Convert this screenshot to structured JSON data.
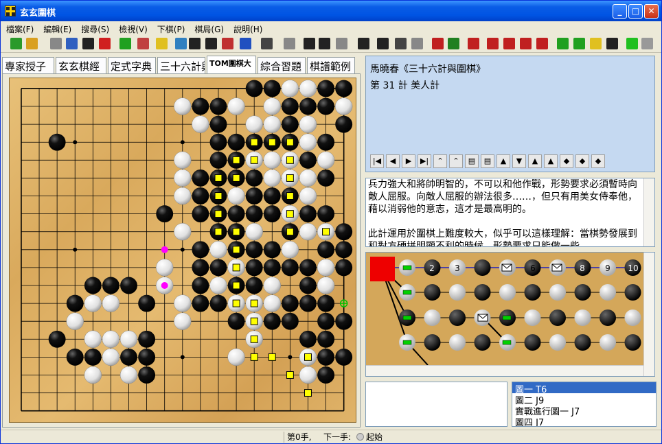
{
  "window": {
    "title": "玄玄圍棋"
  },
  "menu": [
    "檔案(F)",
    "編輯(E)",
    "搜尋(S)",
    "檢視(V)",
    "下棋(P)",
    "棋局(G)",
    "說明(H)"
  ],
  "tabs": [
    "專家授子",
    "玄玄棋經",
    "定式字典",
    "三十六計與",
    "TOM圍棋大",
    "綜合習題",
    "棋譜範例"
  ],
  "info": {
    "line1": "馬曉春《三十六計與圍棋》",
    "line2": "第 31 計  美人計"
  },
  "text": "兵力強大和將帥明智的，不可以和他作戰，形勢要求必須暫時向敵人屈服。向敵人屈服的辦法很多……，但只有用美女侍奉他，藉以消弱他的意志，這才是最高明的。\n\n此計運用於圍棋上難度較大，似乎可以這樣理解：當棋勢發展到和對方硬拼明顯不利的時候，形勢要求只能做一些",
  "tree_labels": [
    "2",
    "3",
    "4",
    "6",
    "8",
    "9",
    "10"
  ],
  "list": [
    "圖一  T6",
    "圖二  J9",
    "實戰進行圖一  J7",
    "圖四  J7"
  ],
  "status": {
    "moves": "第0手,",
    "next": "下一手:",
    "state": "起始"
  },
  "colors": {
    "title_bar": "#0054e3",
    "selected": "#316ac5",
    "board": "#dcb06a",
    "marker_yellow": "#ffff00",
    "marker_magenta": "#ff00ff",
    "tree_root": "#ee0000"
  },
  "board": {
    "size": 19,
    "black": [
      [
        13,
        0
      ],
      [
        14,
        0
      ],
      [
        17,
        0
      ],
      [
        18,
        0
      ],
      [
        10,
        1
      ],
      [
        11,
        1
      ],
      [
        15,
        1
      ],
      [
        16,
        1
      ],
      [
        17,
        1
      ],
      [
        11,
        2
      ],
      [
        15,
        2
      ],
      [
        18,
        2
      ],
      [
        2,
        3
      ],
      [
        11,
        3
      ],
      [
        12,
        3
      ],
      [
        13,
        3
      ],
      [
        14,
        3
      ],
      [
        15,
        3
      ],
      [
        17,
        3
      ],
      [
        11,
        4
      ],
      [
        12,
        4
      ],
      [
        16,
        4
      ],
      [
        10,
        5
      ],
      [
        11,
        5
      ],
      [
        12,
        5
      ],
      [
        13,
        5
      ],
      [
        17,
        5
      ],
      [
        10,
        6
      ],
      [
        11,
        6
      ],
      [
        13,
        6
      ],
      [
        14,
        6
      ],
      [
        15,
        6
      ],
      [
        8,
        7
      ],
      [
        10,
        7
      ],
      [
        11,
        7
      ],
      [
        12,
        7
      ],
      [
        13,
        7
      ],
      [
        14,
        7
      ],
      [
        16,
        7
      ],
      [
        17,
        7
      ],
      [
        11,
        8
      ],
      [
        12,
        8
      ],
      [
        15,
        8
      ],
      [
        18,
        8
      ],
      [
        10,
        9
      ],
      [
        12,
        9
      ],
      [
        13,
        9
      ],
      [
        14,
        9
      ],
      [
        17,
        9
      ],
      [
        18,
        9
      ],
      [
        10,
        10
      ],
      [
        11,
        10
      ],
      [
        13,
        10
      ],
      [
        14,
        10
      ],
      [
        15,
        10
      ],
      [
        16,
        10
      ],
      [
        18,
        10
      ],
      [
        5,
        11
      ],
      [
        4,
        11
      ],
      [
        6,
        11
      ],
      [
        10,
        11
      ],
      [
        12,
        11
      ],
      [
        13,
        11
      ],
      [
        16,
        11
      ],
      [
        3,
        12
      ],
      [
        7,
        12
      ],
      [
        10,
        12
      ],
      [
        11,
        12
      ],
      [
        15,
        12
      ],
      [
        16,
        12
      ],
      [
        17,
        12
      ],
      [
        12,
        13
      ],
      [
        14,
        13
      ],
      [
        15,
        13
      ],
      [
        17,
        13
      ],
      [
        18,
        13
      ],
      [
        2,
        14
      ],
      [
        7,
        14
      ],
      [
        16,
        14
      ],
      [
        17,
        14
      ],
      [
        3,
        15
      ],
      [
        4,
        15
      ],
      [
        6,
        15
      ],
      [
        7,
        15
      ],
      [
        17,
        15
      ],
      [
        18,
        15
      ],
      [
        7,
        16
      ],
      [
        17,
        16
      ]
    ],
    "white": [
      [
        15,
        0
      ],
      [
        16,
        0
      ],
      [
        9,
        1
      ],
      [
        12,
        1
      ],
      [
        14,
        1
      ],
      [
        18,
        1
      ],
      [
        10,
        2
      ],
      [
        13,
        2
      ],
      [
        14,
        2
      ],
      [
        16,
        2
      ],
      [
        12,
        3
      ],
      [
        16,
        3
      ],
      [
        9,
        4
      ],
      [
        13,
        4
      ],
      [
        14,
        4
      ],
      [
        15,
        4
      ],
      [
        17,
        4
      ],
      [
        9,
        5
      ],
      [
        14,
        5
      ],
      [
        15,
        5
      ],
      [
        16,
        5
      ],
      [
        9,
        6
      ],
      [
        12,
        6
      ],
      [
        16,
        6
      ],
      [
        11,
        7
      ],
      [
        15,
        7
      ],
      [
        8,
        7
      ],
      [
        9,
        8
      ],
      [
        11,
        8
      ],
      [
        13,
        8
      ],
      [
        16,
        8
      ],
      [
        17,
        8
      ],
      [
        14,
        9
      ],
      [
        11,
        9
      ],
      [
        15,
        9
      ],
      [
        8,
        10
      ],
      [
        11,
        10
      ],
      [
        12,
        10
      ],
      [
        17,
        10
      ],
      [
        8,
        11
      ],
      [
        5,
        11
      ],
      [
        11,
        11
      ],
      [
        12,
        11
      ],
      [
        14,
        11
      ],
      [
        17,
        11
      ],
      [
        9,
        12
      ],
      [
        4,
        12
      ],
      [
        5,
        12
      ],
      [
        12,
        12
      ],
      [
        13,
        12
      ],
      [
        14,
        12
      ],
      [
        3,
        13
      ],
      [
        9,
        13
      ],
      [
        13,
        13
      ],
      [
        4,
        14
      ],
      [
        5,
        14
      ],
      [
        6,
        14
      ],
      [
        13,
        14
      ],
      [
        16,
        14
      ],
      [
        5,
        15
      ],
      [
        12,
        15
      ],
      [
        16,
        15
      ],
      [
        4,
        16
      ],
      [
        6,
        16
      ],
      [
        16,
        16
      ]
    ],
    "yellow": [
      [
        13,
        3
      ],
      [
        14,
        3
      ],
      [
        15,
        3
      ],
      [
        12,
        4
      ],
      [
        13,
        4
      ],
      [
        15,
        4
      ],
      [
        11,
        5
      ],
      [
        12,
        5
      ],
      [
        15,
        5
      ],
      [
        11,
        6
      ],
      [
        15,
        6
      ],
      [
        11,
        7
      ],
      [
        15,
        7
      ],
      [
        11,
        8
      ],
      [
        12,
        8
      ],
      [
        15,
        8
      ],
      [
        17,
        8
      ],
      [
        12,
        9
      ],
      [
        12,
        10
      ],
      [
        12,
        11
      ],
      [
        12,
        12
      ],
      [
        13,
        12
      ],
      [
        13,
        13
      ],
      [
        13,
        14
      ],
      [
        13,
        15
      ],
      [
        14,
        15
      ],
      [
        16,
        15
      ],
      [
        15,
        16
      ],
      [
        16,
        17
      ]
    ],
    "magenta": [
      [
        8,
        9
      ],
      [
        8,
        11
      ]
    ],
    "green_plus": [
      [
        18,
        12
      ]
    ],
    "hoshi": [
      [
        3,
        3
      ],
      [
        9,
        3
      ],
      [
        15,
        3
      ],
      [
        3,
        9
      ],
      [
        9,
        9
      ],
      [
        15,
        9
      ],
      [
        3,
        15
      ],
      [
        9,
        15
      ],
      [
        15,
        15
      ]
    ]
  }
}
